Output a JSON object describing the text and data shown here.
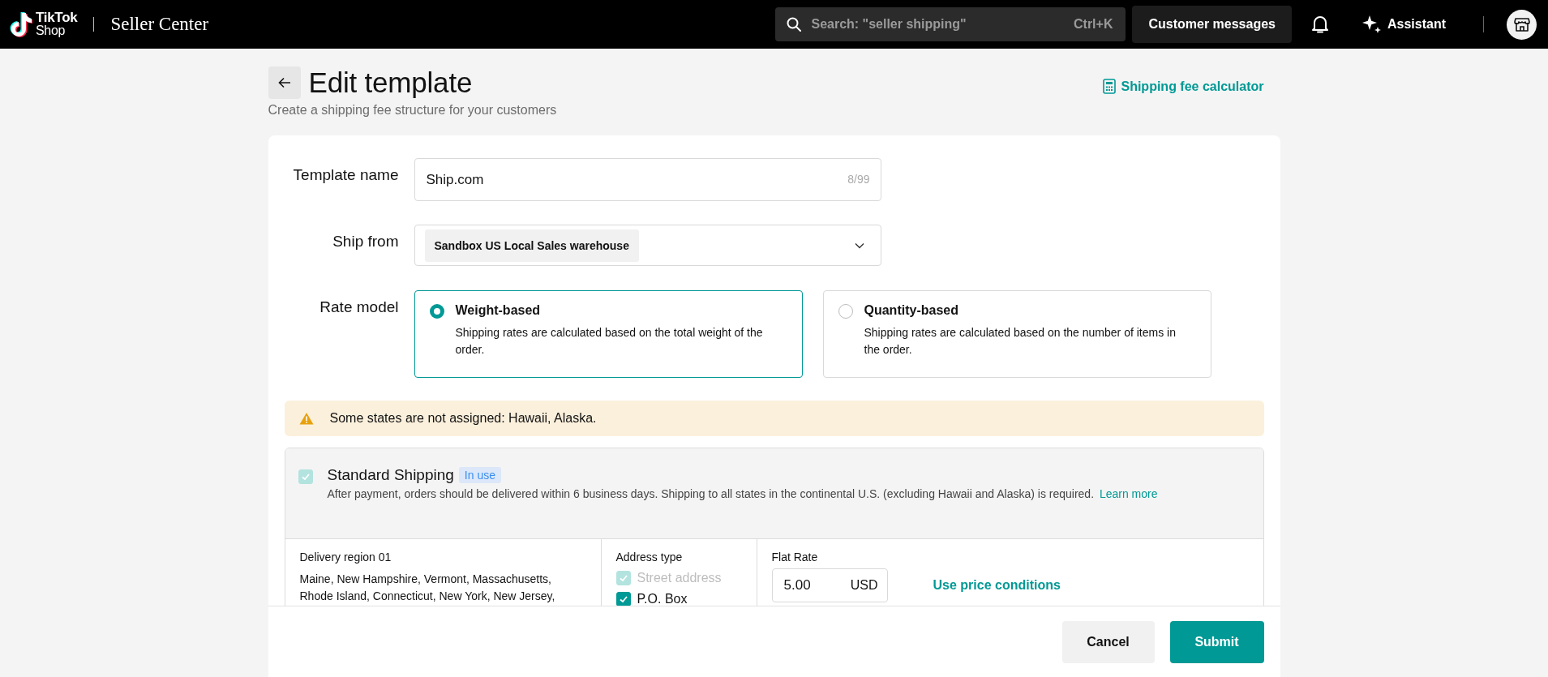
{
  "header": {
    "logo_top": "TikTok",
    "logo_bottom": "Shop",
    "product": "Seller Center",
    "search": {
      "placeholder": "Search: \"seller shipping\"",
      "shortcut": "Ctrl+K"
    },
    "messages_button": "Customer messages",
    "assistant_button": "Assistant"
  },
  "page": {
    "title": "Edit template",
    "subtitle": "Create a shipping fee structure for your customers",
    "calculator_link": "Shipping fee calculator"
  },
  "form": {
    "template_name": {
      "label": "Template name",
      "value": "Ship.com",
      "counter": "8/99"
    },
    "ship_from": {
      "label": "Ship from",
      "value": "Sandbox US Local Sales warehouse"
    },
    "rate_model": {
      "label": "Rate model",
      "options": [
        {
          "title": "Weight-based",
          "description": "Shipping rates are calculated based on the total weight of the order.",
          "selected": true
        },
        {
          "title": "Quantity-based",
          "description": "Shipping rates are calculated based on the number of items in the order.",
          "selected": false
        }
      ]
    }
  },
  "alert": {
    "text": "Some states are not assigned: Hawaii, Alaska."
  },
  "shipping_option": {
    "checked": true,
    "disabled": true,
    "title": "Standard Shipping",
    "badge": "In use",
    "description": "After payment, orders should be delivered within 6 business days. Shipping to all states in the continental U.S. (excluding Hawaii and Alaska) is required.",
    "link": "Learn more",
    "region": {
      "title": "Delivery region 01",
      "states": "Maine, New Hampshire, Vermont, Massachusetts, Rhode Island, Connecticut, New York, New Jersey,"
    },
    "address_type": {
      "label": "Address type",
      "options": [
        {
          "label": "Street address",
          "checked": true,
          "disabled": true
        },
        {
          "label": "P.O. Box",
          "checked": true,
          "disabled": false
        }
      ]
    },
    "flat_rate": {
      "label": "Flat Rate",
      "value": "5.00",
      "currency": "USD"
    },
    "price_conditions_link": "Use price conditions"
  },
  "footer": {
    "buttons": [
      {
        "label": "Cancel",
        "kind": "secondary"
      },
      {
        "label": "Submit",
        "kind": "primary"
      }
    ]
  }
}
